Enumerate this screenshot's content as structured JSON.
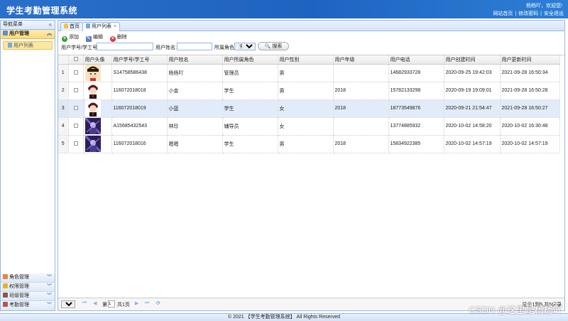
{
  "header": {
    "title": "学生考勤管理系统",
    "welcome": "杨杨吖，欢迎您!",
    "links": [
      "网站首页",
      "修改密码",
      "安全退出"
    ]
  },
  "sidebar": {
    "title": "导航菜单",
    "collapse_icon": "double-chevron-left-icon",
    "groups": [
      {
        "label": "用户管理",
        "expanded": true,
        "items": [
          {
            "label": "用户列表"
          }
        ]
      },
      {
        "label": "角色管理",
        "expanded": false
      },
      {
        "label": "权限管理",
        "expanded": false
      },
      {
        "label": "班级管理",
        "expanded": false
      },
      {
        "label": "考勤管理",
        "expanded": false
      }
    ]
  },
  "tabs": [
    {
      "label": "首页",
      "active": false
    },
    {
      "label": "用户列表",
      "active": true,
      "closable": true
    }
  ],
  "toolbar": {
    "add": "添加",
    "edit": "编辑",
    "delete": "删除"
  },
  "search": {
    "account_label": "用户学号/学工号:",
    "account_value": "",
    "name_label": "用户姓名:",
    "name_value": "",
    "role_label": "所属角色:",
    "role_selected": "全部",
    "button": "搜索"
  },
  "grid": {
    "columns": [
      "用户头像",
      "用户学号/学工号",
      "用户姓名",
      "用户所属角色",
      "用户性别",
      "用户年级",
      "用户电话",
      "用户创建时间",
      "用户更新时间"
    ],
    "rows": [
      {
        "n": "1",
        "avatar": "cartoon-girl",
        "account": "S14758586438",
        "name": "杨杨吖",
        "role": "管理员",
        "gender": "男",
        "grade": "",
        "phone": "14682933728",
        "created": "2020-09-25 19:42:03",
        "updated": "2021-09-28 16:50:34"
      },
      {
        "n": "2",
        "avatar": "anime-boy",
        "account": "116072018018",
        "name": "小金",
        "role": "学生",
        "gender": "男",
        "grade": "2018",
        "phone": "15782133298",
        "created": "2020-09-19 19:09:01",
        "updated": "2021-09-28 16:50:28"
      },
      {
        "n": "3",
        "avatar": "anime-boy",
        "account": "116072018019",
        "name": "小蓝",
        "role": "学生",
        "gender": "女",
        "grade": "2018",
        "phone": "18773549876",
        "created": "2020-09-21 21:54:47",
        "updated": "2021-09-28 16:50:27"
      },
      {
        "n": "4",
        "avatar": "purple-portrait",
        "account": "A15685432543",
        "name": "林珍",
        "role": "辅导员",
        "gender": "女",
        "grade": "",
        "phone": "13774885932",
        "created": "2020-10-02 14:58:20",
        "updated": "2020-10-02 16:30:48"
      },
      {
        "n": "5",
        "avatar": "purple-portrait",
        "account": "116072018016",
        "name": "嗯嗯",
        "role": "学生",
        "gender": "男",
        "grade": "2018",
        "phone": "15834922385",
        "created": "2020-10-02 14:57:19",
        "updated": "2020-10-02 14:57:19"
      }
    ],
    "selected_row": 3
  },
  "pager": {
    "page_size": "10",
    "page_prefix": "第",
    "page_value": "1",
    "page_suffix": "共1页",
    "summary": "显示1到5,共5记录"
  },
  "footer": "© 2021 【学生考勤管理系统】 All Rights Reserved",
  "watermark": "CSDN @这里是杨杨吖"
}
